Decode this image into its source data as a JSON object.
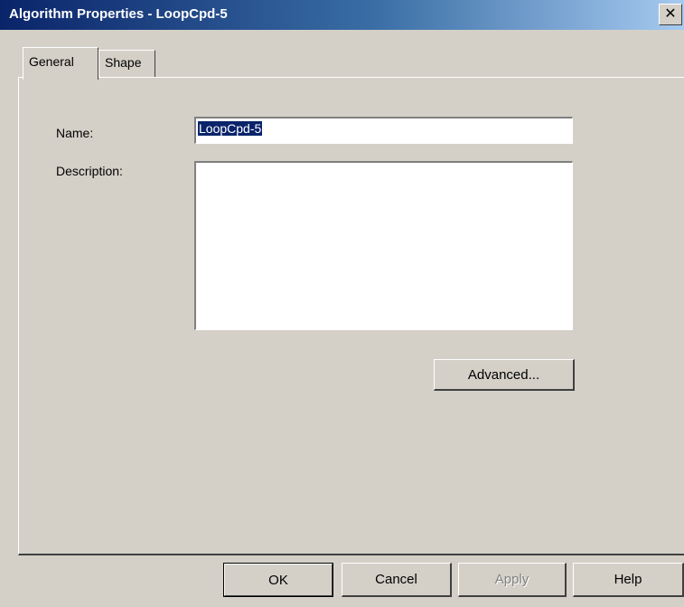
{
  "window": {
    "title": "Algorithm Properties - LoopCpd-5",
    "close_glyph": "✕",
    "close_icon": "close-icon"
  },
  "tabs": [
    {
      "label": "General",
      "selected": true
    },
    {
      "label": "Shape",
      "selected": false
    }
  ],
  "form": {
    "name_label": "Name:",
    "name_value": "LoopCpd-5",
    "description_label": "Description:",
    "description_value": "",
    "advanced_label": "Advanced..."
  },
  "footer": {
    "ok_label": "OK",
    "cancel_label": "Cancel",
    "apply_label": "Apply",
    "apply_enabled": false,
    "help_label": "Help"
  },
  "colors": {
    "titlebar_start": "#0a246a",
    "titlebar_end": "#a6caf0",
    "face": "#d4d0c8",
    "selection": "#0a246a"
  }
}
